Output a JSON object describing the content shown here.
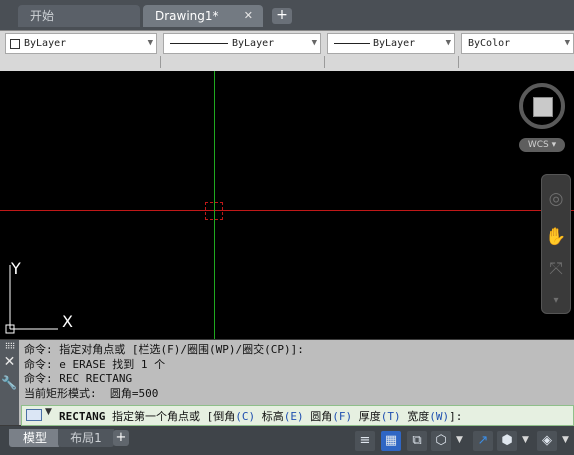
{
  "tabs": {
    "start_label": "开始",
    "active_label": "Drawing1*",
    "close_glyph": "✕",
    "add_glyph": "+"
  },
  "properties": {
    "color": "ByLayer",
    "linetype": "ByLayer",
    "lineweight": "ByLayer",
    "plotstyle": "ByColor"
  },
  "canvas": {
    "ucs_y_label": "Y",
    "ucs_x_label": "X",
    "wcs_label": "WCS",
    "axis_x_color": "#c01818",
    "axis_y_color": "#1fa81f"
  },
  "command": {
    "history": [
      "命令: 指定对角点或 [栏选(F)/圈围(WP)/圈交(CP)]:",
      "命令: e ERASE 找到 1 个",
      "命令: REC RECTANG",
      "当前矩形模式:  圆角=500"
    ],
    "prompt_name": "RECTANG",
    "prompt_text": "指定第一个角点或 [",
    "options": [
      {
        "label": "倒角",
        "key": "(C)"
      },
      {
        "label": "标高",
        "key": "(E)"
      },
      {
        "label": "圆角",
        "key": "(F)"
      },
      {
        "label": "厚度",
        "key": "(T)"
      },
      {
        "label": "宽度",
        "key": "(W)"
      }
    ],
    "prompt_end": "]:"
  },
  "layout_tabs": {
    "model": "模型",
    "layout1": "布局1",
    "add": "+"
  }
}
